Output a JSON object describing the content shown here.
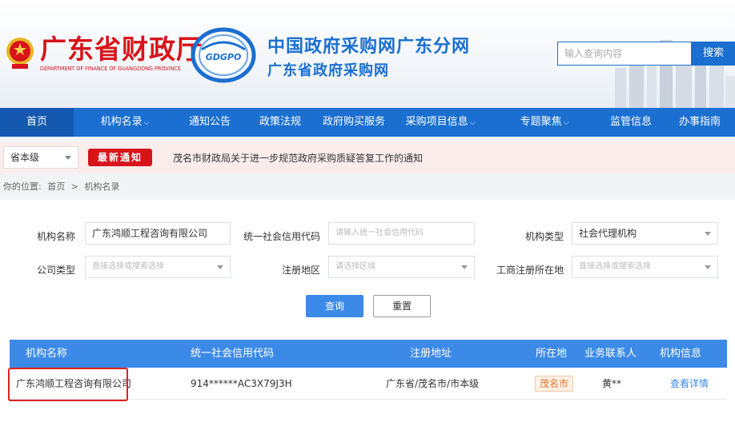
{
  "header": {
    "dept_cn": "广东省财政厅",
    "dept_en": "DEPARTMENT OF FINANCE OF GUANGDONG PROVINCE",
    "logo_text": "GDGPO",
    "title_main": "中国政府采购网广东分网",
    "title_sub": "广东省政府采购网",
    "search_placeholder": "输入查询内容",
    "search_label": "搜索"
  },
  "nav": {
    "items": [
      {
        "label": "首页",
        "active": true
      },
      {
        "label": "机构名录",
        "dropdown": true
      },
      {
        "label": "通知公告"
      },
      {
        "label": "政策法规"
      },
      {
        "label": "政府购买服务"
      },
      {
        "label": "采购项目信息",
        "dropdown": true
      },
      {
        "label": "专题聚焦",
        "dropdown": true
      },
      {
        "label": "监管信息"
      },
      {
        "label": "办事指南"
      }
    ],
    "chevron": "⌵"
  },
  "notice": {
    "level": "省本级",
    "badge": "最新通知",
    "text": "茂名市财政局关于进一步规范政府采购质疑答复工作的通知"
  },
  "breadcrumb": {
    "prefix": "你的位置:",
    "home": "首页",
    "sep": ">",
    "current": "机构名录"
  },
  "form": {
    "name_label": "机构名称",
    "name_value": "广东鸿顺工程咨询有限公司",
    "credit_label": "统一社会信用代码",
    "credit_placeholder": "请输入统一社会信用代码",
    "type_label": "机构类型",
    "type_value": "社会代理机构",
    "company_type_label": "公司类型",
    "company_type_placeholder": "直接选择或搜索选择",
    "region_label": "注册地区",
    "region_placeholder": "请选择区域",
    "biz_region_label": "工商注册所在地",
    "biz_region_placeholder": "直接选择或搜索选择",
    "query_label": "查询",
    "reset_label": "重置"
  },
  "table": {
    "headers": [
      "机构名称",
      "统一社会信用代码",
      "注册地址",
      "所在地",
      "业务联系人",
      "机构信息"
    ],
    "rows": [
      {
        "name": "广东鸿顺工程咨询有限公司",
        "credit_code": "914******AC3X79J3H",
        "address": "广东省/茂名市/市本级",
        "city": "茂名市",
        "contact": "黄**",
        "action": "查看详情"
      }
    ]
  },
  "colors": {
    "brand_blue": "#1a6fd0",
    "table_blue": "#3c8ae8",
    "dept_red": "#d7141a",
    "highlight_red": "#e02020",
    "tag_orange": "#e8742a"
  }
}
